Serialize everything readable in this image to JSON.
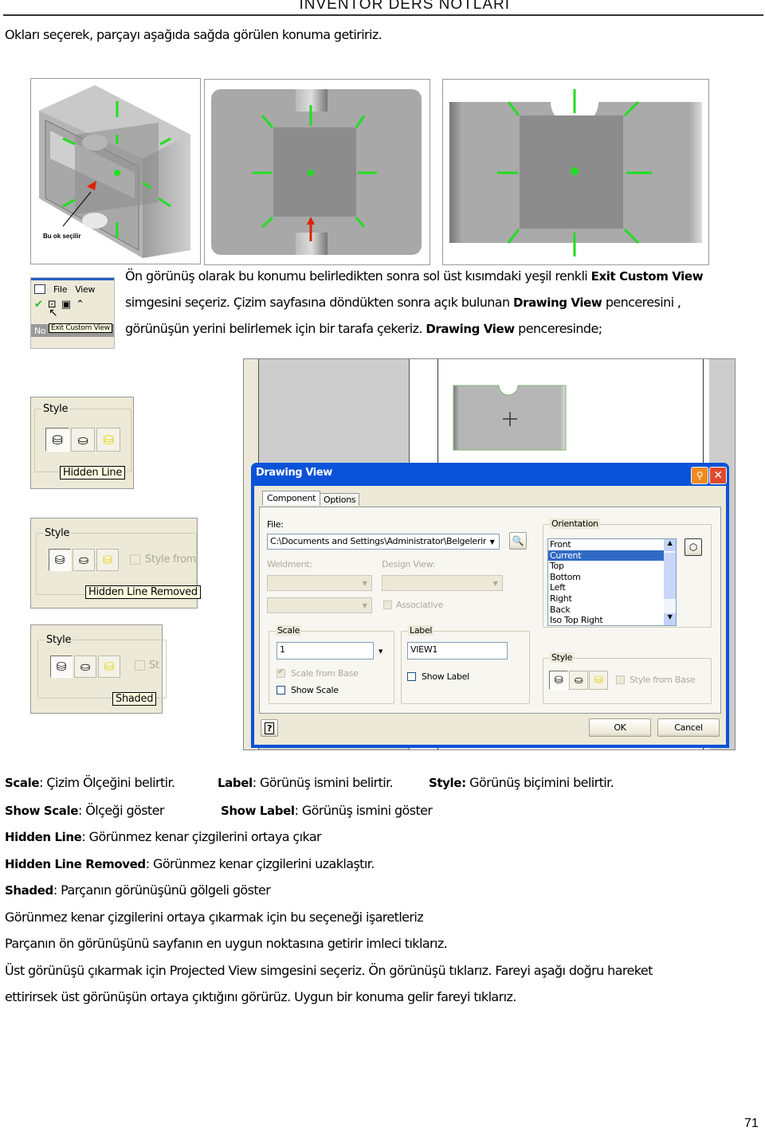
{
  "header": {
    "title": "INVENTOR DERS NOTLARI"
  },
  "intro": {
    "text": "Okları seçerek,  parçayı aşağıda sağda görülen konuma getiririz."
  },
  "figures": {
    "iso_view": {
      "caption": "Bu ok seçilir",
      "arrow_color": "#22dd22",
      "selected_arrow_color": "#dd2200"
    },
    "front_view_1": {},
    "front_view_2": {}
  },
  "toolbar_snippet": {
    "menu": [
      "File",
      "View"
    ],
    "tooltip": "Exit Custom View",
    "status_fragment": "No"
  },
  "paragraph1": {
    "line1_pre": "Ön görünüş olarak bu konumu belirledikten sonra sol üst kısımdaki yeşil renkli ",
    "line1_bold": "Exit Custom View",
    "line2_pre": "simgesini seçeriz. Çizim sayfasına döndükten sonra açık bulunan ",
    "line2_bold": "Drawing View",
    "line2_post": " penceresini ,",
    "line3_pre": "görünüşün yerini belirlemek için bir tarafa çekeriz.  ",
    "line3_bold": "Drawing View",
    "line3_post": " penceresinde;"
  },
  "style_snippets": [
    {
      "group_title": "Style",
      "tooltip": "Hidden Line",
      "checkbox_label": ""
    },
    {
      "group_title": "Style",
      "tooltip": "Hidden Line Removed",
      "checkbox_label": "Style from"
    },
    {
      "group_title": "Style",
      "tooltip": "Shaded",
      "checkbox_label": "St"
    }
  ],
  "dialog": {
    "title": "Drawing View",
    "tabs": [
      "Component",
      "Options"
    ],
    "active_tab": "Component",
    "file_label": "File:",
    "file_value": "C:\\Documents and Settings\\Administrator\\Belgelerim\\r",
    "weldment_label": "Weldment:",
    "design_view_label": "Design View:",
    "associative_label": "Associative",
    "orientation": {
      "title": "Orientation",
      "items": [
        "Front",
        "Current",
        "Top",
        "Bottom",
        "Left",
        "Right",
        "Back",
        "Iso Top Right"
      ],
      "selected": "Current"
    },
    "scale": {
      "title": "Scale",
      "value": "1",
      "scale_from_base_label": "Scale from Base",
      "scale_from_base_checked": true,
      "show_scale_label": "Show Scale",
      "show_scale_checked": false
    },
    "label": {
      "title": "Label",
      "value": "VIEW1",
      "show_label_label": "Show Label",
      "show_label_checked": false
    },
    "style": {
      "title": "Style",
      "style_from_base_label": "Style from Base",
      "selected": "Hidden Line"
    },
    "ok_label": "OK",
    "cancel_label": "Cancel",
    "help_label": "?",
    "colors": {
      "titlebar": "#0a52d8",
      "selection": "#316ac5",
      "close": "#e04a2a",
      "pin": "#f08a20"
    }
  },
  "definitions": [
    {
      "parts": [
        {
          "term": "Scale",
          "desc": ":  Çizim Ölçeğini belirtir."
        },
        {
          "term": "Label",
          "desc": ": Görünüş ismini belirtir."
        },
        {
          "term": "Style:",
          "desc": " Görünüş biçimini belirtir."
        }
      ]
    },
    {
      "parts": [
        {
          "term": "Show Scale",
          "desc": ": Ölçeği göster"
        },
        {
          "term": "Show Label",
          "desc": ": Görünüş ismini göster"
        }
      ]
    },
    {
      "parts": [
        {
          "term": "Hidden Line",
          "desc": ": Görünmez kenar çizgilerini ortaya çıkar"
        }
      ]
    },
    {
      "parts": [
        {
          "term": "Hidden Line Removed",
          "desc": ": Görünmez kenar çizgilerini uzaklaştır."
        }
      ]
    },
    {
      "parts": [
        {
          "term": "Shaded",
          "desc": ": Parçanın görünüşünü gölgeli göster"
        }
      ]
    }
  ],
  "closing_lines": [
    "Görünmez kenar çizgilerini ortaya çıkarmak için bu seçeneği işaretleriz",
    "Parçanın ön görünüşünü sayfanın en uygun noktasına getirir imleci tıklarız.",
    "Üst görünüşü çıkarmak için Projected View simgesini seçeriz. Ön görünüşü tıklarız. Fareyi aşağı doğru hareket",
    "ettirirsek üst görünüşün ortaya çıktığını görürüz. Uygun bir konuma gelir fareyi tıklarız."
  ],
  "footer": {
    "page_number": "71"
  }
}
